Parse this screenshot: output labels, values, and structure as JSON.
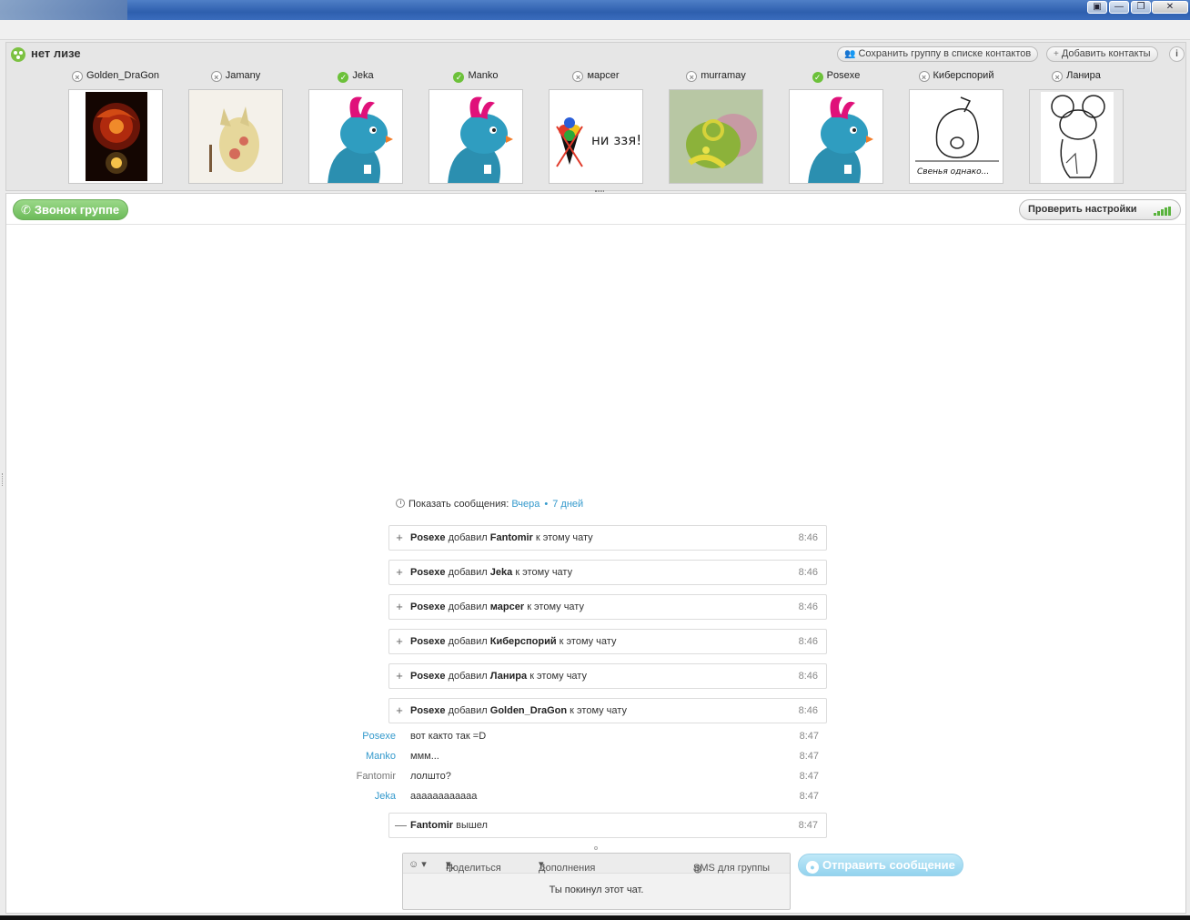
{
  "window": {
    "buttons": [
      "▣",
      "—",
      "❐",
      "✕"
    ]
  },
  "group": {
    "title": "нет лизе",
    "save_group_label": "Сохранить группу в списке контактов",
    "add_contacts_label": "Добавить контакты",
    "info_label": "i",
    "members": [
      {
        "name": "Golden_DraGon",
        "online": false,
        "avatar": "dragon-art"
      },
      {
        "name": "Jamany",
        "online": false,
        "avatar": "fox-art"
      },
      {
        "name": "Jeka",
        "online": true,
        "avatar": "blue-creature"
      },
      {
        "name": "Manko",
        "online": true,
        "avatar": "blue-creature"
      },
      {
        "name": "марcer",
        "online": false,
        "avatar": "doodle",
        "avatar_text": "ни ззя!"
      },
      {
        "name": "murramay",
        "online": false,
        "avatar": "green-creature"
      },
      {
        "name": "Posexe",
        "online": true,
        "avatar": "blue-creature"
      },
      {
        "name": "Киберспорий",
        "online": false,
        "avatar": "pig-sketch",
        "avatar_text": "Свенья однако..."
      },
      {
        "name": "Ланира",
        "online": false,
        "avatar": "mouse-sketch"
      }
    ]
  },
  "toolbar": {
    "call_label": "Звонок группе",
    "check_settings_label": "Проверить настройки"
  },
  "history": {
    "label": "Показать сообщения:",
    "yesterday": "Вчера",
    "seven_days": "7 дней"
  },
  "events": [
    {
      "sign": "+",
      "actor": "Posexe",
      "verb": "добавил",
      "target": "Fantomir",
      "suffix": "к этому чату",
      "time": "8:46"
    },
    {
      "sign": "+",
      "actor": "Posexe",
      "verb": "добавил",
      "target": "Jeka",
      "suffix": "к этому чату",
      "time": "8:46"
    },
    {
      "sign": "+",
      "actor": "Posexe",
      "verb": "добавил",
      "target": "марcer",
      "suffix": "к этому чату",
      "time": "8:46"
    },
    {
      "sign": "+",
      "actor": "Posexe",
      "verb": "добавил",
      "target": "Киберспорий",
      "suffix": "к этому чату",
      "time": "8:46"
    },
    {
      "sign": "+",
      "actor": "Posexe",
      "verb": "добавил",
      "target": "Ланира",
      "suffix": "к этому чату",
      "time": "8:46"
    },
    {
      "sign": "+",
      "actor": "Posexe",
      "verb": "добавил",
      "target": "Golden_DraGon",
      "suffix": "к этому чату",
      "time": "8:46"
    }
  ],
  "messages": [
    {
      "author": "Posexe",
      "text": "вот както так =D",
      "time": "8:47",
      "color": "blue"
    },
    {
      "author": "Manko",
      "text": "ммм...",
      "time": "8:47",
      "color": "blue"
    },
    {
      "author": "Fantomir",
      "text": "лолшто?",
      "time": "8:47",
      "color": "grey"
    },
    {
      "author": "Jeka",
      "text": "аааааааааааа",
      "time": "8:47",
      "color": "blue"
    }
  ],
  "leave_event": {
    "sign": "—",
    "actor": "Fantomir",
    "text": "вышел",
    "time": "8:47"
  },
  "composer": {
    "emoticon": "☺ ▾",
    "share_label": "Поделиться",
    "extras_label": "Дополнения",
    "sms_label": "SMS для группы",
    "status_text": "Ты покинул этот чат.",
    "send_label": "Отправить сообщение"
  },
  "colors": {
    "link": "#3399cc",
    "call_green": "#6dbb5a",
    "send_blue": "#93d3ee"
  }
}
